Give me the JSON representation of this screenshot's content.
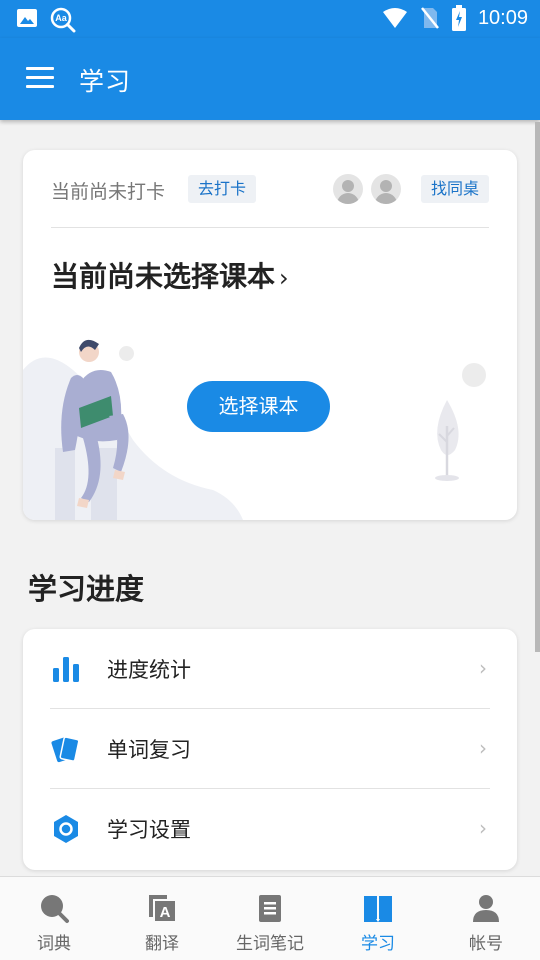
{
  "status_bar": {
    "time": "10:09"
  },
  "app_bar": {
    "title": "学习"
  },
  "checkin_card": {
    "status_text": "当前尚未打卡",
    "checkin_label": "去打卡",
    "find_deskmate_label": "找同桌",
    "textbook_heading": "当前尚未选择课本",
    "heading_chevron": "›",
    "choose_textbook_label": "选择课本"
  },
  "progress": {
    "title": "学习进度",
    "items": [
      {
        "label": "进度统计",
        "icon": "bar-chart-icon"
      },
      {
        "label": "单词复习",
        "icon": "word-cards-icon"
      },
      {
        "label": "学习设置",
        "icon": "settings-hexagon-icon"
      }
    ],
    "chevron": "›"
  },
  "bottom_nav": {
    "items": [
      {
        "label": "词典",
        "icon": "dictionary-search-icon"
      },
      {
        "label": "翻译",
        "icon": "translate-icon"
      },
      {
        "label": "生词笔记",
        "icon": "notebook-icon"
      },
      {
        "label": "学习",
        "icon": "book-icon"
      },
      {
        "label": "帐号",
        "icon": "account-icon"
      }
    ],
    "active_index": 3
  },
  "colors": {
    "primary": "#1a8ae5",
    "background": "#f2f2f2",
    "inactive_icon": "#777777"
  }
}
